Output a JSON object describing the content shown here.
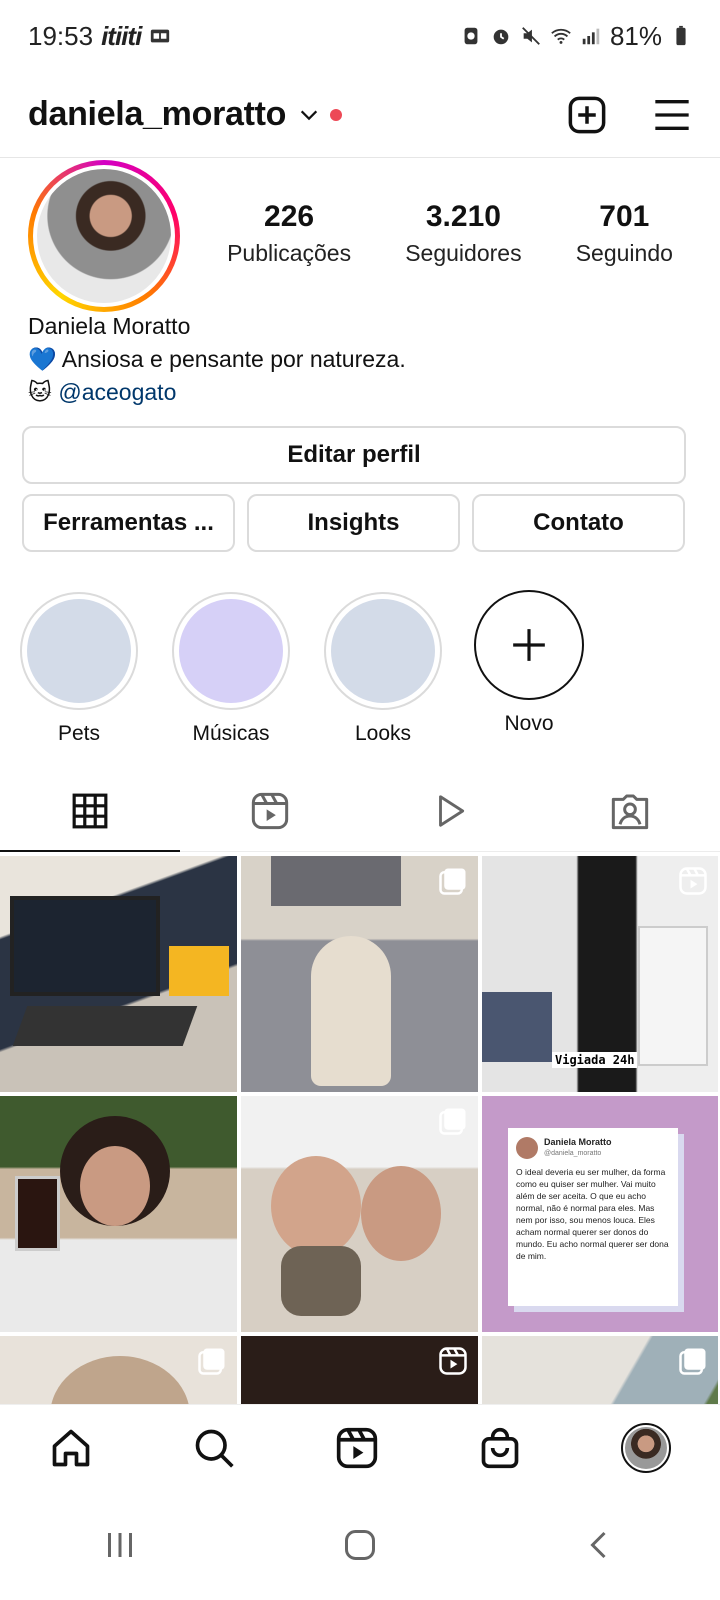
{
  "status_bar": {
    "time": "19:53",
    "carrier": "itiiti",
    "battery": "81%"
  },
  "header": {
    "username": "daniela_moratto"
  },
  "stats": [
    {
      "value": "226",
      "label": "Publicações"
    },
    {
      "value": "3.210",
      "label": "Seguidores"
    },
    {
      "value": "701",
      "label": "Seguindo"
    }
  ],
  "bio": {
    "name": "Daniela Moratto",
    "line1_emoji": "💙",
    "line1": "Ansiosa e pensante por natureza.",
    "line2_emoji": "🐱",
    "line2_link": "@aceogato"
  },
  "buttons": {
    "edit_profile": "Editar perfil",
    "tools": "Ferramentas ...",
    "insights": "Insights",
    "contact": "Contato"
  },
  "highlights": [
    {
      "label": "Pets",
      "color": "#d3dbe8"
    },
    {
      "label": "Músicas",
      "color": "#d6d0f7"
    },
    {
      "label": "Looks",
      "color": "#d3dbe8"
    },
    {
      "label": "Novo"
    }
  ],
  "tabs": [
    "grid-icon",
    "reels-icon",
    "play-icon",
    "tagged-icon"
  ],
  "grid": {
    "cell3_caption": "Vigiada 24h",
    "tweet": {
      "name": "Daniela Moratto",
      "handle": "@daniela_moratto",
      "text": "O ideal deveria eu ser mulher, da forma como eu quiser ser mulher. Vai muito além de ser aceita. O que eu acho normal, não é normal para eles. Mas nem por isso, sou menos louca. Eles acham normal querer ser donos do mundo. Eu acho normal querer ser dona de mim."
    }
  },
  "colors": {
    "accent_link": "#00376b",
    "notification_dot": "#ed4956",
    "tweet_bg": "#c49ac9"
  }
}
